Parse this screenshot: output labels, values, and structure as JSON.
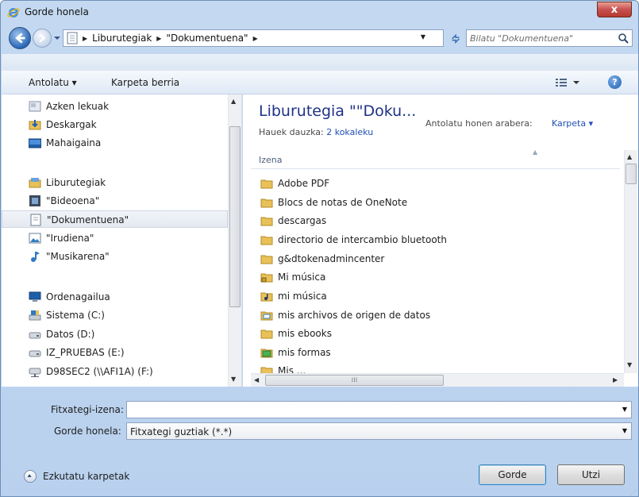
{
  "window": {
    "title": "Gorde honela",
    "close_label": "x"
  },
  "address": {
    "crumbs": [
      "Liburutegiak",
      "\"Dokumentuena\""
    ],
    "search_placeholder": "Bilatu \"Dokumentuena\""
  },
  "toolbar": {
    "organize_label": "Antolatu ▾",
    "new_folder_label": "Karpeta berria",
    "help_label": "?"
  },
  "navpane": {
    "items": [
      {
        "label": "Azken lekuak",
        "icon": "recent-places-icon"
      },
      {
        "label": "Deskargak",
        "icon": "downloads-folder-icon"
      },
      {
        "label": "Mahaigaina",
        "icon": "desktop-icon"
      },
      {
        "label": "Liburutegiak",
        "icon": "libraries-icon"
      },
      {
        "label": "\"Bideoena\"",
        "icon": "videos-library-icon"
      },
      {
        "label": "\"Dokumentuena\"",
        "icon": "documents-library-icon"
      },
      {
        "label": "\"Irudiena\"",
        "icon": "pictures-library-icon"
      },
      {
        "label": "\"Musikarena\"",
        "icon": "music-library-icon"
      },
      {
        "label": "Ordenagailua",
        "icon": "computer-icon"
      },
      {
        "label": "Sistema (C:)",
        "icon": "system-drive-icon"
      },
      {
        "label": "Datos (D:)",
        "icon": "drive-icon"
      },
      {
        "label": "IZ_PRUEBAS (E:)",
        "icon": "drive-icon"
      },
      {
        "label": "D98SEC2 (\\\\AFI1A) (F:)",
        "icon": "network-drive-icon"
      }
    ]
  },
  "content": {
    "library_title": "Liburutegia \"\"Doku...",
    "includes_label": "Hauek dauzka:",
    "includes_value": "2 kokaleku",
    "arrange_label": "Antolatu honen arabera:",
    "arrange_value": "Karpeta ▾",
    "column_name": "Izena",
    "files": [
      {
        "label": "Adobe PDF",
        "icon": "folder-icon"
      },
      {
        "label": "Blocs de notas de OneNote",
        "icon": "folder-icon"
      },
      {
        "label": "descargas",
        "icon": "folder-icon"
      },
      {
        "label": "directorio de intercambio bluetooth",
        "icon": "folder-icon"
      },
      {
        "label": "g&dtokenadmincenter",
        "icon": "folder-icon"
      },
      {
        "label": "Mi música",
        "icon": "locked-folder-icon"
      },
      {
        "label": "mi música",
        "icon": "music-folder-icon"
      },
      {
        "label": "mis archivos de origen de datos",
        "icon": "data-sources-icon"
      },
      {
        "label": "mis ebooks",
        "icon": "folder-icon"
      },
      {
        "label": "mis formas",
        "icon": "forms-icon"
      },
      {
        "label": "Mis ...",
        "icon": "folder-icon"
      }
    ]
  },
  "form": {
    "filename_label": "Fitxategi-izena:",
    "filename_value": "",
    "savetype_label": "Gorde honela:",
    "savetype_value": "Fitxategi guztiak (*.*)",
    "hide_folders_label": "Ezkutatu karpetak",
    "save_label": "Gorde",
    "cancel_label": "Utzi"
  },
  "colors": {
    "title_blue": "#1e3287",
    "link_blue": "#1e4fb5",
    "close_red": "#c75050"
  }
}
